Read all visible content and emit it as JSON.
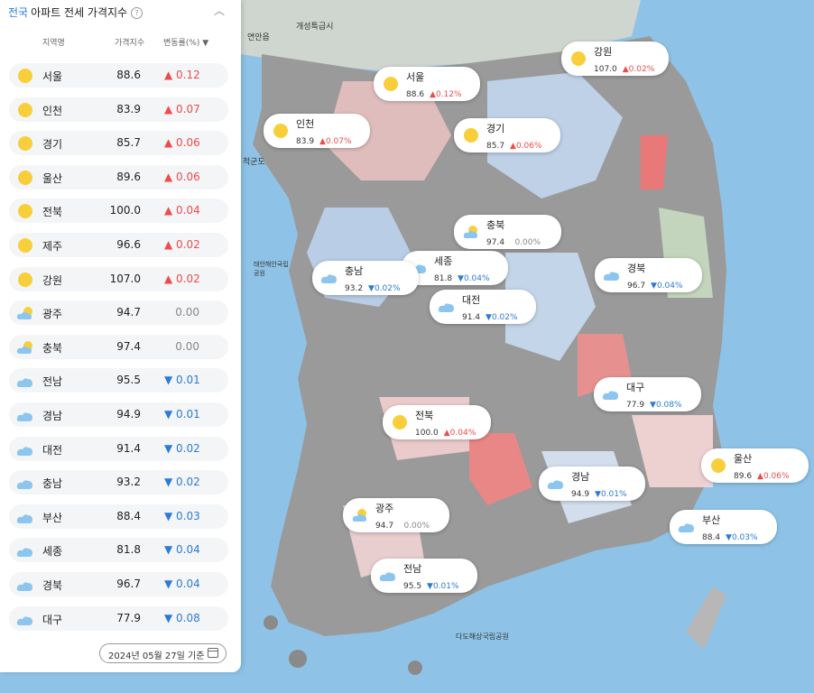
{
  "panel": {
    "scope_label": "전국",
    "title": "아파트 전세 가격지수",
    "help_icon": "question-circle-icon",
    "collapse_glyph": "︿",
    "header": {
      "region": "지역명",
      "index": "가격지수",
      "change": "변동률(%) ▼"
    },
    "rows": [
      {
        "region": "서울",
        "index": "88.6",
        "change": "▲ 0.12",
        "weather": "sun"
      },
      {
        "region": "인천",
        "index": "83.9",
        "change": "▲ 0.07",
        "weather": "sun"
      },
      {
        "region": "경기",
        "index": "85.7",
        "change": "▲ 0.06",
        "weather": "sun"
      },
      {
        "region": "울산",
        "index": "89.6",
        "change": "▲ 0.06",
        "weather": "sun"
      },
      {
        "region": "전북",
        "index": "100.0",
        "change": "▲ 0.04",
        "weather": "sun"
      },
      {
        "region": "제주",
        "index": "96.6",
        "change": "▲ 0.02",
        "weather": "sun"
      },
      {
        "region": "강원",
        "index": "107.0",
        "change": "▲ 0.02",
        "weather": "sun"
      },
      {
        "region": "광주",
        "index": "94.7",
        "change": "0.00",
        "weather": "partly-cloudy"
      },
      {
        "region": "충북",
        "index": "97.4",
        "change": "0.00",
        "weather": "partly-cloudy"
      },
      {
        "region": "전남",
        "index": "95.5",
        "change": "▼ 0.01",
        "weather": "cloud"
      },
      {
        "region": "경남",
        "index": "94.9",
        "change": "▼ 0.01",
        "weather": "cloud"
      },
      {
        "region": "대전",
        "index": "91.4",
        "change": "▼ 0.02",
        "weather": "cloud"
      },
      {
        "region": "충남",
        "index": "93.2",
        "change": "▼ 0.02",
        "weather": "cloud"
      },
      {
        "region": "부산",
        "index": "88.4",
        "change": "▼ 0.03",
        "weather": "cloud"
      },
      {
        "region": "세종",
        "index": "81.8",
        "change": "▼ 0.04",
        "weather": "cloud"
      },
      {
        "region": "경북",
        "index": "96.7",
        "change": "▼ 0.04",
        "weather": "cloud"
      },
      {
        "region": "대구",
        "index": "77.9",
        "change": "▼ 0.08",
        "weather": "cloud"
      }
    ],
    "date_label": "2024년 05월 27일 기준",
    "calendar_icon": "calendar-icon"
  },
  "map": {
    "labels": [
      "개성특급시",
      "연안읍",
      "적군도",
      "태안해안국립공원",
      "다도해상국립공원"
    ],
    "pins": [
      {
        "region": "강원",
        "index": "107.0",
        "change": "▲0.02%",
        "weather": "sun"
      },
      {
        "region": "서울",
        "index": "88.6",
        "change": "▲0.12%",
        "weather": "sun"
      },
      {
        "region": "인천",
        "index": "83.9",
        "change": "▲0.07%",
        "weather": "sun"
      },
      {
        "region": "경기",
        "index": "85.7",
        "change": "▲0.06%",
        "weather": "sun"
      },
      {
        "region": "충북",
        "index": "97.4",
        "change": "0.00%",
        "weather": "partly-cloudy"
      },
      {
        "region": "세종",
        "index": "81.8",
        "change": "▼0.04%",
        "weather": "cloud"
      },
      {
        "region": "충남",
        "index": "93.2",
        "change": "▼0.02%",
        "weather": "cloud"
      },
      {
        "region": "경북",
        "index": "96.7",
        "change": "▼0.04%",
        "weather": "cloud"
      },
      {
        "region": "대전",
        "index": "91.4",
        "change": "▼0.02%",
        "weather": "cloud"
      },
      {
        "region": "대구",
        "index": "77.9",
        "change": "▼0.08%",
        "weather": "cloud"
      },
      {
        "region": "전북",
        "index": "100.0",
        "change": "▲0.04%",
        "weather": "sun"
      },
      {
        "region": "울산",
        "index": "89.6",
        "change": "▲0.06%",
        "weather": "sun"
      },
      {
        "region": "경남",
        "index": "94.9",
        "change": "▼0.01%",
        "weather": "cloud"
      },
      {
        "region": "광주",
        "index": "94.7",
        "change": "0.00%",
        "weather": "partly-cloudy"
      },
      {
        "region": "부산",
        "index": "88.4",
        "change": "▼0.03%",
        "weather": "cloud"
      },
      {
        "region": "전남",
        "index": "95.5",
        "change": "▼0.01%",
        "weather": "cloud"
      }
    ]
  }
}
